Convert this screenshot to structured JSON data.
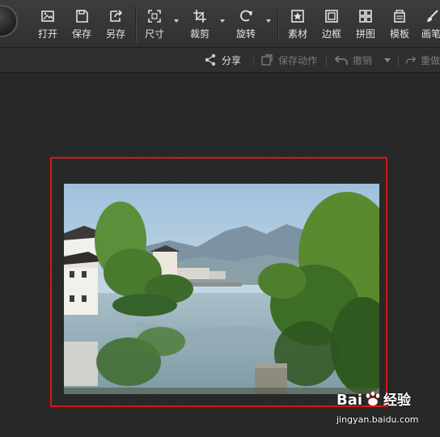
{
  "toolbar": {
    "buttons": [
      {
        "label": "打开",
        "icon": "open-image-icon"
      },
      {
        "label": "保存",
        "icon": "save-icon"
      },
      {
        "label": "另存",
        "icon": "save-as-icon"
      },
      {
        "label": "尺寸",
        "icon": "resize-icon"
      },
      {
        "label": "裁剪",
        "icon": "crop-icon"
      },
      {
        "label": "旋转",
        "icon": "rotate-icon"
      },
      {
        "label": "素材",
        "icon": "star-material-icon"
      },
      {
        "label": "边框",
        "icon": "frame-icon"
      },
      {
        "label": "拼图",
        "icon": "collage-icon"
      },
      {
        "label": "模板",
        "icon": "template-icon"
      },
      {
        "label": "画笔",
        "icon": "brush-icon"
      }
    ]
  },
  "actionbar": {
    "share_label": "分享",
    "save_action_label": "保存动作",
    "undo_label": "撤销",
    "redo_label": "重做"
  },
  "watermark": {
    "brand_left": "Bai",
    "brand_right": "经验",
    "url": "jingyan.baidu.com"
  },
  "colors": {
    "selection_border": "#dd1515",
    "toolbar_bg": "#363636",
    "canvas_bg": "#2a2a2a"
  }
}
